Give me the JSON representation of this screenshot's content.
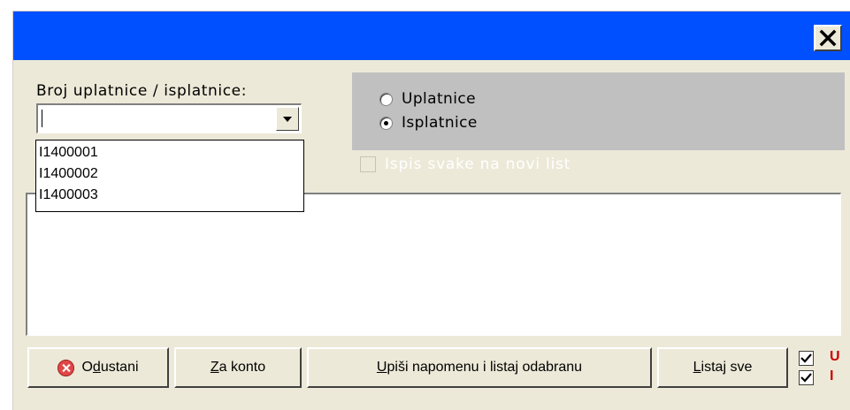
{
  "dialog": {
    "close_icon": "close-icon"
  },
  "form": {
    "broj_label": "Broj uplatnice / isplatnice:",
    "combo_value": "",
    "dropdown_options": [
      "I1400001",
      "I1400002",
      "I1400003"
    ]
  },
  "radio_group": {
    "options": [
      {
        "label": "Uplatnice",
        "checked": false
      },
      {
        "label": "Isplatnice",
        "checked": true
      }
    ]
  },
  "checkbox_novi_list": {
    "label": "Ispis svake na novi list",
    "checked": false,
    "enabled": false
  },
  "memo": {
    "value": ""
  },
  "buttons": {
    "odustani": {
      "before": "O",
      "mnemonic": "d",
      "after": "ustani"
    },
    "za_konto": {
      "before": "",
      "mnemonic": "Z",
      "after": "a konto"
    },
    "upisi": {
      "before": "",
      "mnemonic": "U",
      "after": "piši napomenu i listaj odabranu"
    },
    "listaj_sve": {
      "before": "",
      "mnemonic": "L",
      "after": "istaj sve"
    }
  },
  "mini_checks": [
    {
      "letter": "U",
      "checked": true
    },
    {
      "letter": "I",
      "checked": true
    }
  ],
  "colors": {
    "titlebar": "#0050ff",
    "window_bg": "#ece9d8",
    "radio_panel": "#c0c0c0",
    "indicator_letters": "#cc0000"
  }
}
